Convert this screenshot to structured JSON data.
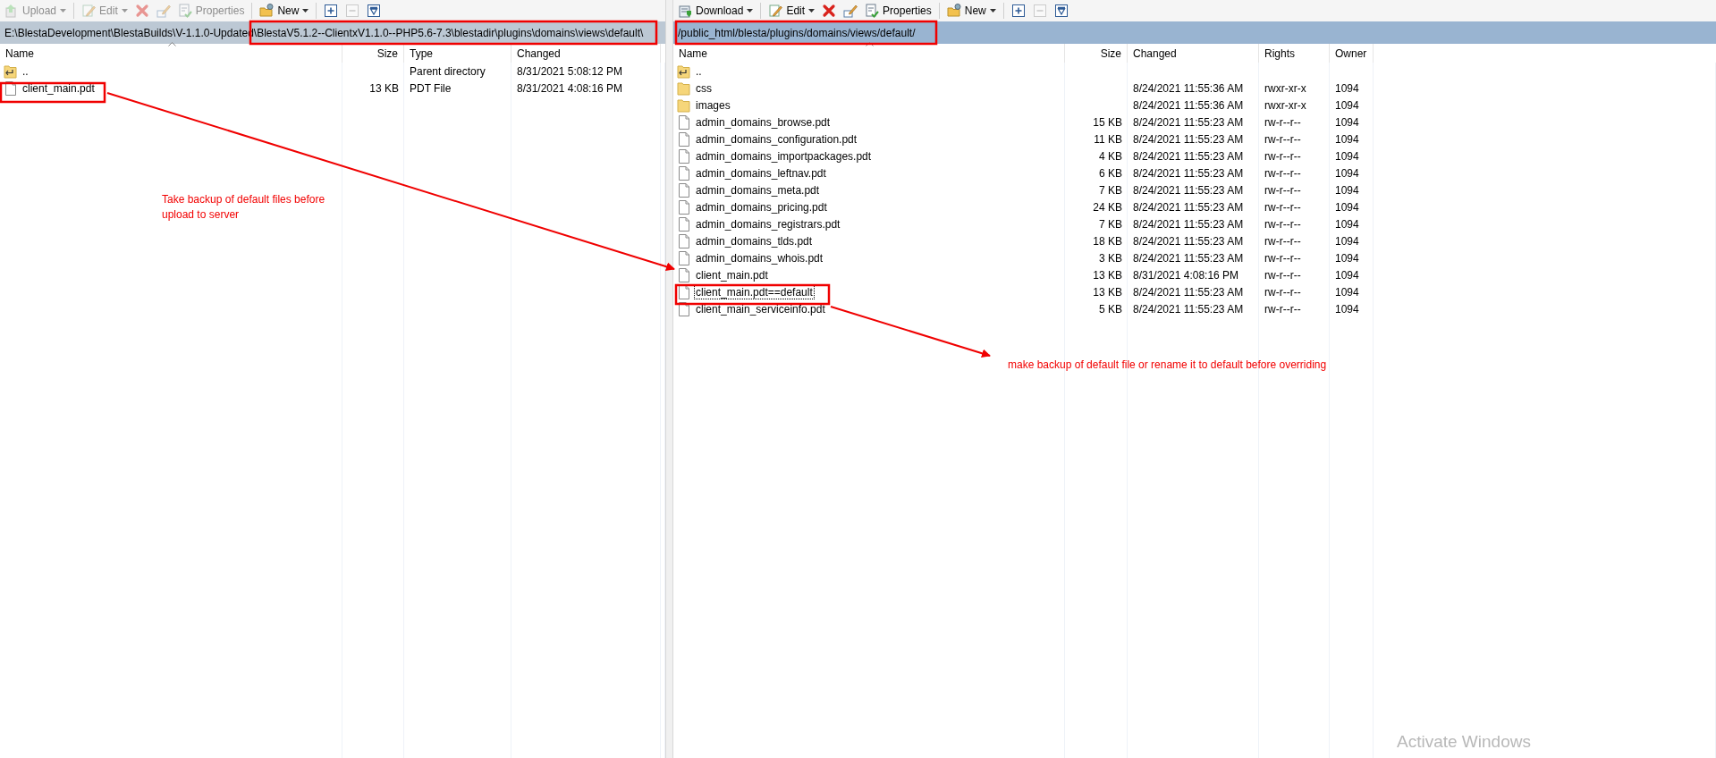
{
  "panels": [
    {
      "active": false,
      "toolbar": [
        {
          "kind": "upload",
          "label": "Upload",
          "dropdown": true,
          "disabled": true
        },
        {
          "kind": "separator"
        },
        {
          "kind": "edit",
          "label": "Edit",
          "dropdown": true,
          "disabled": true
        },
        {
          "kind": "delete",
          "dropdown": false,
          "disabled": true
        },
        {
          "kind": "rename",
          "dropdown": false,
          "disabled": true
        },
        {
          "kind": "properties",
          "label": "Properties",
          "dropdown": false,
          "disabled": true
        },
        {
          "kind": "separator"
        },
        {
          "kind": "new",
          "label": "New",
          "dropdown": true,
          "disabled": false
        },
        {
          "kind": "separator"
        },
        {
          "kind": "expand",
          "dropdown": false,
          "disabled": false
        },
        {
          "kind": "collapse",
          "dropdown": false,
          "disabled": true
        },
        {
          "kind": "filter",
          "dropdown": false,
          "disabled": false
        }
      ],
      "path": "E:\\BlestaDevelopment\\BlestaBuilds\\V-1.1.0-Updated\\BlestaV5.1.2--ClientxV1.1.0--PHP5.6-7.3\\blestadir\\plugins\\domains\\views\\default\\",
      "columns": [
        {
          "kind": "name",
          "label": "Name",
          "sorted": true
        },
        {
          "kind": "size",
          "label": "Size",
          "sorted": false
        },
        {
          "kind": "type",
          "label": "Type",
          "sorted": false
        },
        {
          "kind": "changed",
          "label": "Changed",
          "sorted": false
        }
      ],
      "files": [
        {
          "kind": "parent",
          "focused": false,
          "cells": [
            "..",
            null,
            "Parent directory",
            "8/31/2021  5:08:12 PM"
          ]
        },
        {
          "kind": "file",
          "focused": false,
          "cells": [
            "client_main.pdt",
            "13 KB",
            "PDT File",
            "8/31/2021  4:08:16 PM"
          ]
        }
      ]
    },
    {
      "active": true,
      "toolbar": [
        {
          "kind": "download",
          "label": "Download",
          "dropdown": true,
          "disabled": false
        },
        {
          "kind": "separator"
        },
        {
          "kind": "edit",
          "label": "Edit",
          "dropdown": true,
          "disabled": false
        },
        {
          "kind": "delete",
          "dropdown": false,
          "disabled": false
        },
        {
          "kind": "rename",
          "dropdown": false,
          "disabled": false
        },
        {
          "kind": "properties",
          "label": "Properties",
          "dropdown": false,
          "disabled": false
        },
        {
          "kind": "separator"
        },
        {
          "kind": "new",
          "label": "New",
          "dropdown": true,
          "disabled": false
        },
        {
          "kind": "separator"
        },
        {
          "kind": "expand",
          "dropdown": false,
          "disabled": false
        },
        {
          "kind": "collapse",
          "dropdown": false,
          "disabled": true
        },
        {
          "kind": "filter",
          "dropdown": false,
          "disabled": false
        }
      ],
      "path": "/public_html/blesta/plugins/domains/views/default/",
      "columns": [
        {
          "kind": "name",
          "label": "Name",
          "sorted": true
        },
        {
          "kind": "size",
          "label": "Size",
          "sorted": false
        },
        {
          "kind": "changed",
          "label": "Changed",
          "sorted": false
        },
        {
          "kind": "rights",
          "label": "Rights",
          "sorted": false
        },
        {
          "kind": "owner",
          "label": "Owner",
          "sorted": false
        }
      ],
      "files": [
        {
          "kind": "parent",
          "focused": false,
          "cells": [
            "..",
            null,
            null,
            null,
            null
          ]
        },
        {
          "kind": "folder",
          "focused": false,
          "cells": [
            "css",
            null,
            "8/24/2021 11:55:36 AM",
            "rwxr-xr-x",
            "1094"
          ]
        },
        {
          "kind": "folder",
          "focused": false,
          "cells": [
            "images",
            null,
            "8/24/2021 11:55:36 AM",
            "rwxr-xr-x",
            "1094"
          ]
        },
        {
          "kind": "file",
          "focused": false,
          "cells": [
            "admin_domains_browse.pdt",
            "15 KB",
            "8/24/2021 11:55:23 AM",
            "rw-r--r--",
            "1094"
          ]
        },
        {
          "kind": "file",
          "focused": false,
          "cells": [
            "admin_domains_configuration.pdt",
            "11 KB",
            "8/24/2021 11:55:23 AM",
            "rw-r--r--",
            "1094"
          ]
        },
        {
          "kind": "file",
          "focused": false,
          "cells": [
            "admin_domains_importpackages.pdt",
            "4 KB",
            "8/24/2021 11:55:23 AM",
            "rw-r--r--",
            "1094"
          ]
        },
        {
          "kind": "file",
          "focused": false,
          "cells": [
            "admin_domains_leftnav.pdt",
            "6 KB",
            "8/24/2021 11:55:23 AM",
            "rw-r--r--",
            "1094"
          ]
        },
        {
          "kind": "file",
          "focused": false,
          "cells": [
            "admin_domains_meta.pdt",
            "7 KB",
            "8/24/2021 11:55:23 AM",
            "rw-r--r--",
            "1094"
          ]
        },
        {
          "kind": "file",
          "focused": false,
          "cells": [
            "admin_domains_pricing.pdt",
            "24 KB",
            "8/24/2021 11:55:23 AM",
            "rw-r--r--",
            "1094"
          ]
        },
        {
          "kind": "file",
          "focused": false,
          "cells": [
            "admin_domains_registrars.pdt",
            "7 KB",
            "8/24/2021 11:55:23 AM",
            "rw-r--r--",
            "1094"
          ]
        },
        {
          "kind": "file",
          "focused": false,
          "cells": [
            "admin_domains_tlds.pdt",
            "18 KB",
            "8/24/2021 11:55:23 AM",
            "rw-r--r--",
            "1094"
          ]
        },
        {
          "kind": "file",
          "focused": false,
          "cells": [
            "admin_domains_whois.pdt",
            "3 KB",
            "8/24/2021 11:55:23 AM",
            "rw-r--r--",
            "1094"
          ]
        },
        {
          "kind": "file",
          "focused": false,
          "cells": [
            "client_main.pdt",
            "13 KB",
            "8/31/2021 4:08:16 PM",
            "rw-r--r--",
            "1094"
          ]
        },
        {
          "kind": "file",
          "focused": true,
          "cells": [
            "client_main.pdt==default",
            "13 KB",
            "8/24/2021 11:55:23 AM",
            "rw-r--r--",
            "1094"
          ]
        },
        {
          "kind": "file",
          "focused": false,
          "cells": [
            "client_main_serviceinfo.pdt",
            "5 KB",
            "8/24/2021 11:55:23 AM",
            "rw-r--r--",
            "1094"
          ]
        }
      ]
    }
  ],
  "annotations": [
    {
      "text": "Take backup of default files before upload to server"
    },
    {
      "text": "make backup of default file or rename it to default before overriding"
    }
  ],
  "os_notice": "Activate Windows"
}
